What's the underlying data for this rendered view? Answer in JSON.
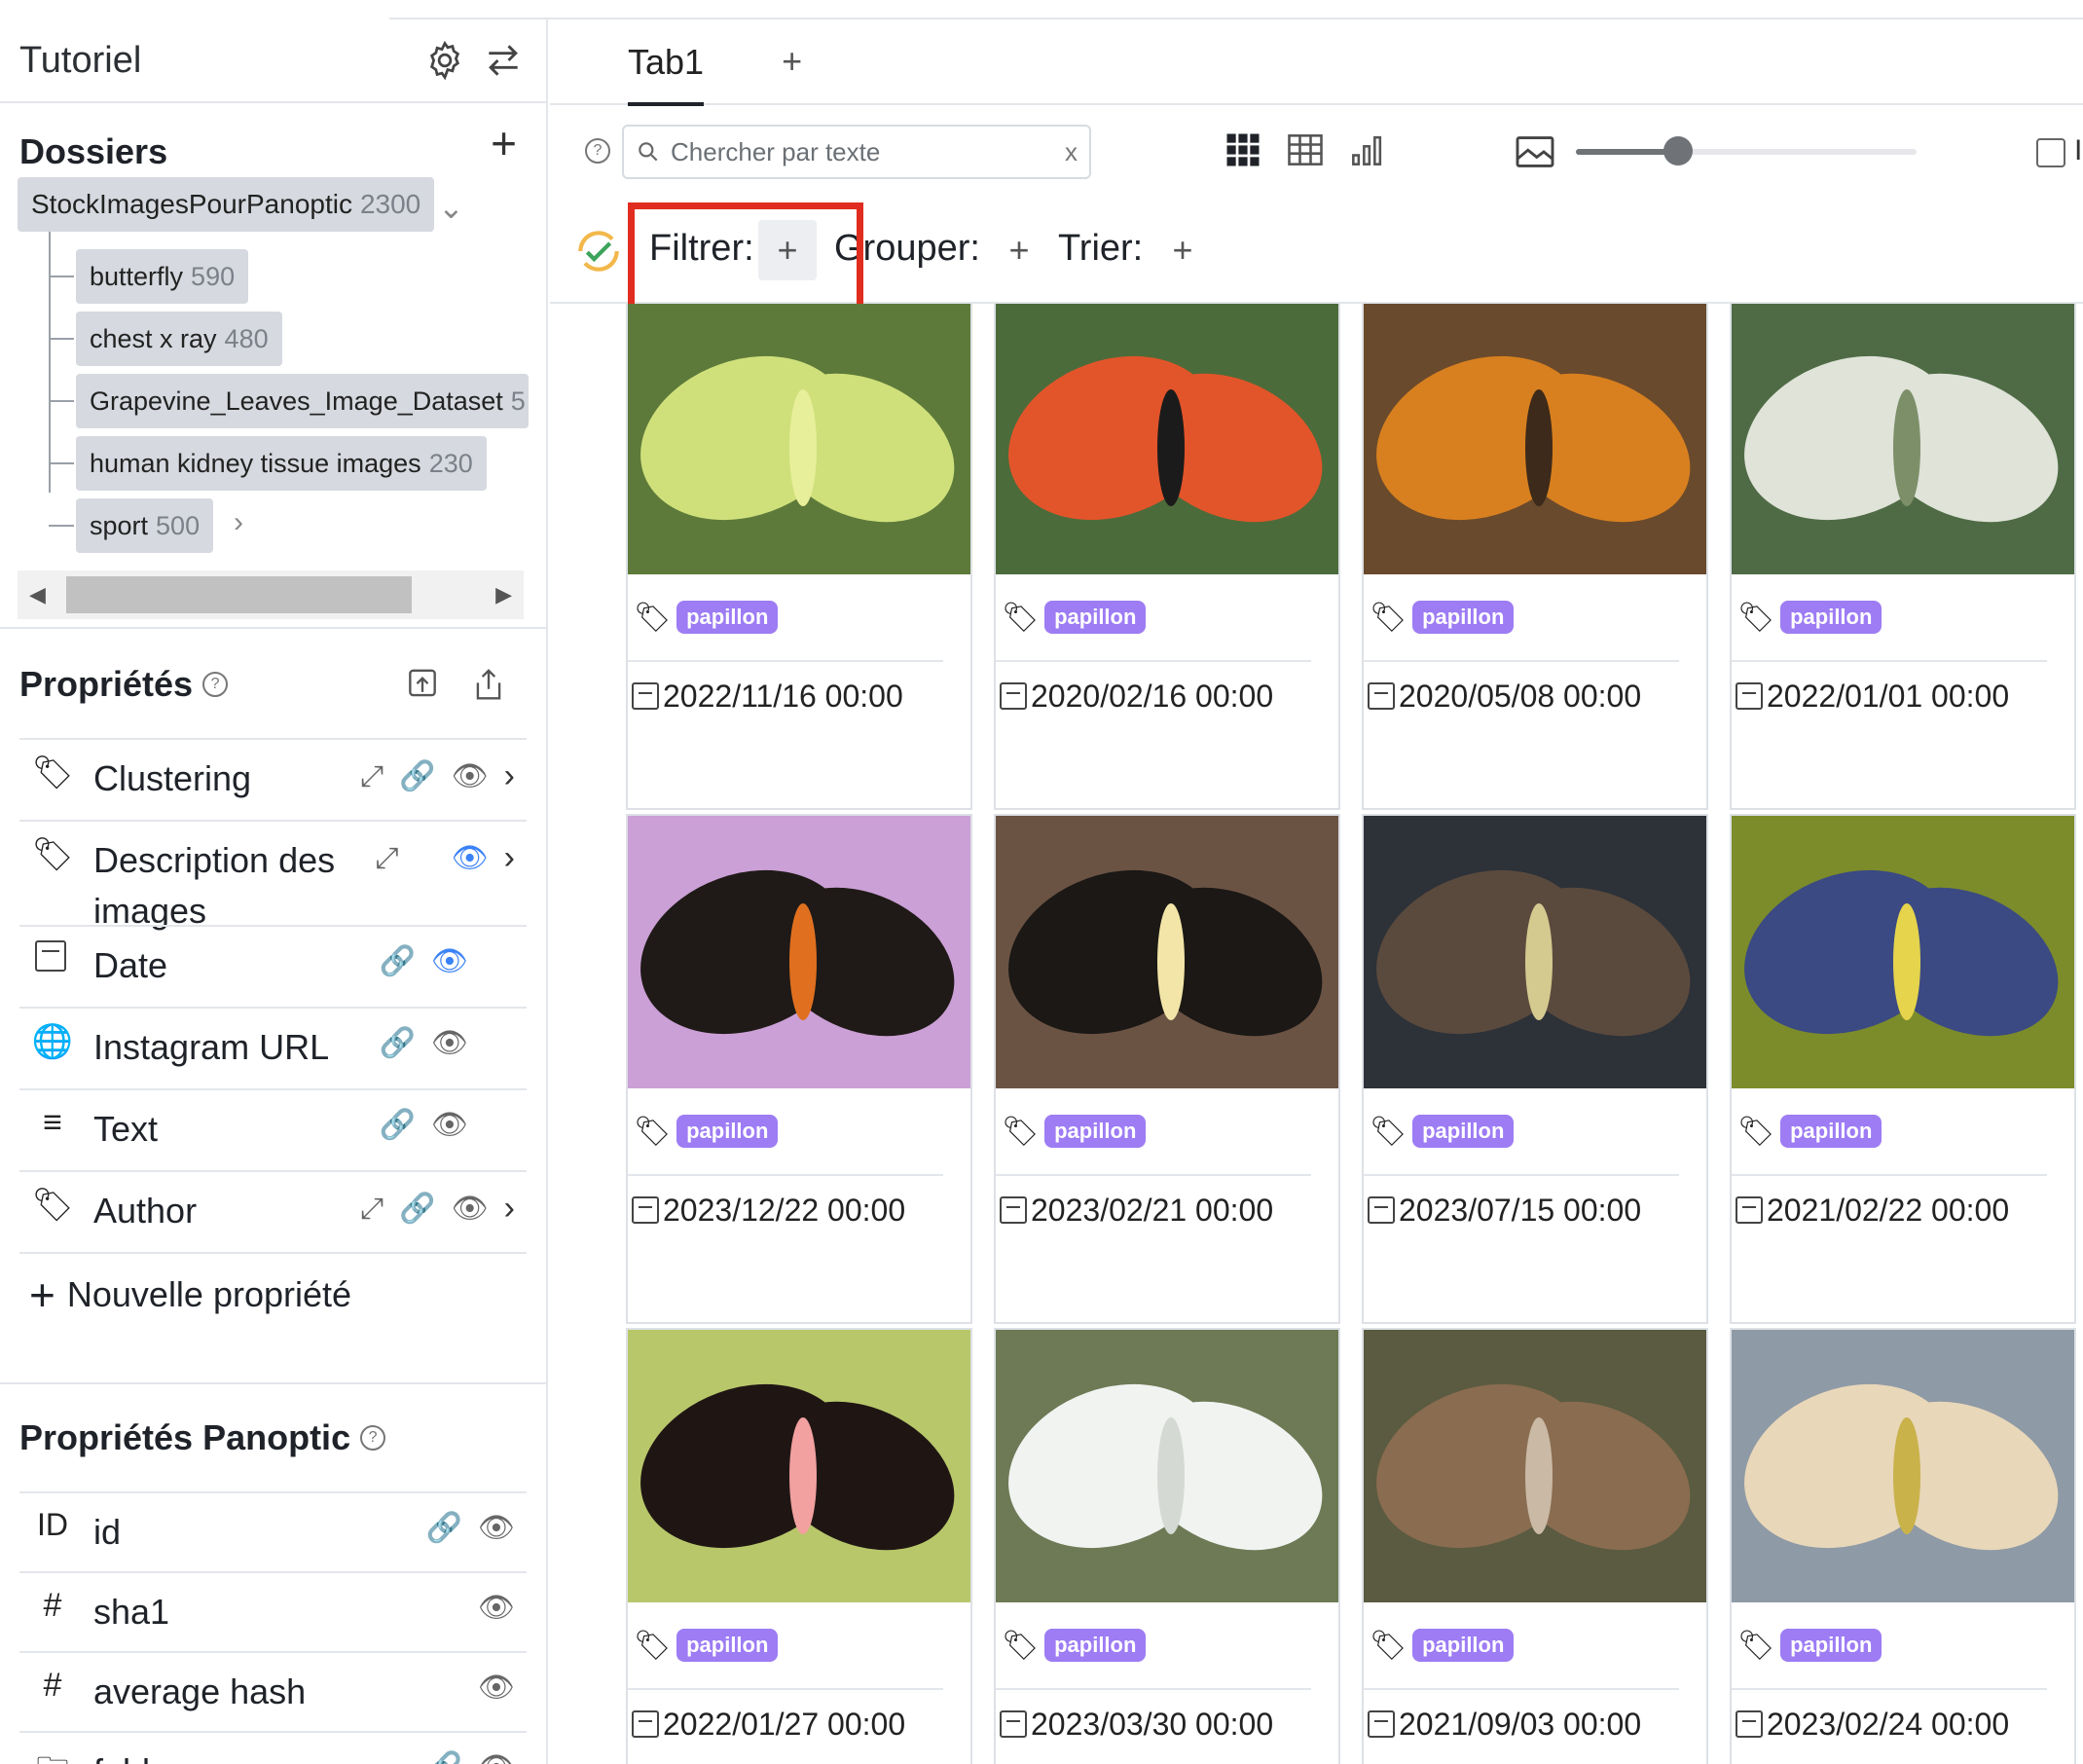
{
  "sidebar": {
    "title": "Tutoriel",
    "folders": {
      "heading": "Dossiers",
      "root": {
        "name": "StockImagesPourPanoptic",
        "count": "2300"
      },
      "items": [
        {
          "name": "butterfly",
          "count": "590"
        },
        {
          "name": "chest x ray",
          "count": "480"
        },
        {
          "name": "Grapevine_Leaves_Image_Dataset",
          "count": "5"
        },
        {
          "name": "human kidney tissue images",
          "count": "230"
        },
        {
          "name": "sport",
          "count": "500"
        }
      ]
    },
    "properties": {
      "heading": "Propriétés",
      "help": "?",
      "items": [
        {
          "name": "Clustering",
          "icon": "tag-icon"
        },
        {
          "name": "Description des images",
          "icon": "tag-icon"
        },
        {
          "name": "Date",
          "icon": "calendar-icon"
        },
        {
          "name": "Instagram URL",
          "icon": "globe-icon"
        },
        {
          "name": "Text",
          "icon": "text-lines-icon"
        },
        {
          "name": "Author",
          "icon": "tag-icon"
        }
      ],
      "new_property": "Nouvelle propriété"
    },
    "panoptic_properties": {
      "heading": "Propriétés Panoptic",
      "items": [
        {
          "prefix": "ID",
          "name": "id"
        },
        {
          "prefix": "#",
          "name": "sha1"
        },
        {
          "prefix": "#",
          "name": "average hash"
        },
        {
          "prefix": "folder-icon",
          "name": "folder"
        }
      ]
    }
  },
  "main": {
    "tabs": [
      {
        "label": "Tab1"
      }
    ],
    "tab_add": "+",
    "search": {
      "placeholder": "Chercher par texte",
      "value": "",
      "clear": "x"
    },
    "toolbar": {
      "filter_label": "Filtrer:",
      "group_label": "Grouper:",
      "sort_label": "Trier:",
      "plus": "+"
    },
    "zoom_level": 0.3,
    "checkbox_label": "I",
    "grid": [
      {
        "tag": "papillon",
        "date": "2022/11/16 00:00"
      },
      {
        "tag": "papillon",
        "date": "2020/02/16 00:00"
      },
      {
        "tag": "papillon",
        "date": "2020/05/08 00:00"
      },
      {
        "tag": "papillon",
        "date": "2022/01/01 00:00"
      },
      {
        "tag": "papillon",
        "date": "2023/12/22 00:00"
      },
      {
        "tag": "papillon",
        "date": "2023/02/21 00:00"
      },
      {
        "tag": "papillon",
        "date": "2023/07/15 00:00"
      },
      {
        "tag": "papillon",
        "date": "2021/02/22 00:00"
      },
      {
        "tag": "papillon",
        "date": "2022/01/27 00:00"
      },
      {
        "tag": "papillon",
        "date": "2023/03/30 00:00"
      },
      {
        "tag": "papillon",
        "date": "2021/09/03 00:00"
      },
      {
        "tag": "papillon",
        "date": "2023/02/24 00:00"
      }
    ]
  },
  "colors": {
    "accent_highlight": "#e02d1f",
    "tag_badge": "#9d7cf4",
    "eye_active": "#3b82f6"
  }
}
